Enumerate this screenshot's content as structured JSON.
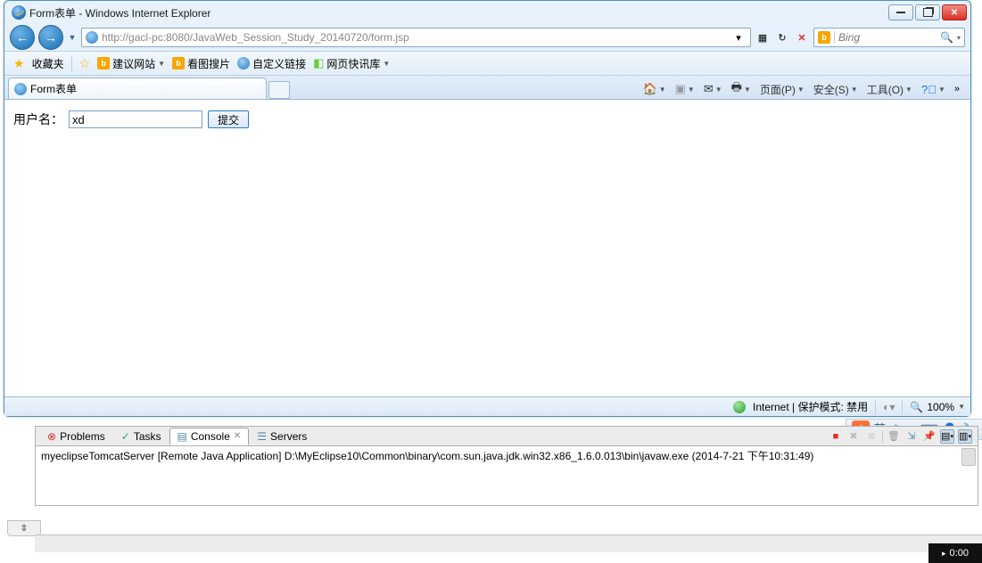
{
  "window": {
    "title": "Form表单 - Windows Internet Explorer"
  },
  "nav": {
    "url": "http://gacl-pc:8080/JavaWeb_Session_Study_20140720/form.jsp",
    "search_engine": "Bing"
  },
  "favbar": {
    "label": "收藏夹",
    "items": [
      "建议网站",
      "看图搜片",
      "自定义链接",
      "网页快讯库"
    ]
  },
  "tab": {
    "title": "Form表单"
  },
  "toolbar": {
    "page": "页面(P)",
    "safety": "安全(S)",
    "tools": "工具(O)"
  },
  "form": {
    "label": "用户名：",
    "value": "xd",
    "submit": "提交"
  },
  "status": {
    "zone": "Internet | 保护模式: 禁用",
    "zoom": "100%"
  },
  "eclipse": {
    "tabs": {
      "problems": "Problems",
      "tasks": "Tasks",
      "console": "Console",
      "servers": "Servers"
    },
    "console_line": "myeclipseTomcatServer [Remote Java Application] D:\\MyEclipse10\\Common\\binary\\com.sun.java.jdk.win32.x86_1.6.0.013\\bin\\javaw.exe (2014-7-21 下午10:31:49)"
  },
  "ime": {
    "lang": "英"
  },
  "clock": "0:00"
}
